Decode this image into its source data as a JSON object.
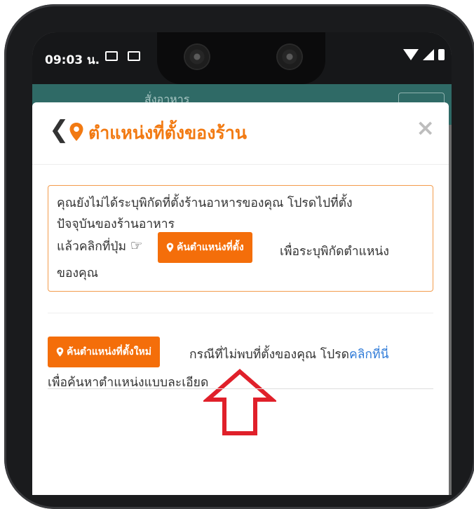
{
  "status_bar": {
    "time": "09:03 น.",
    "icons": [
      "gallery-icon",
      "gmail-icon",
      "wifi-icon",
      "signal-icon",
      "battery-icon"
    ]
  },
  "app_header": {
    "title": "สั่งอาหาร"
  },
  "modal": {
    "title": "ตำแหน่งที่ตั้งของร้าน",
    "close_label": "×",
    "back_label": "❮",
    "notice": {
      "line1": "คุณยังไม่ได้ระบุพิกัดที่ตั้งร้านอาหารของคุณ โปรดไปที่ตั้ง",
      "line2": "ปัจจุบันของร้านอาหาร",
      "line3_prefix": "แล้วคลิกที่ปุ่ม",
      "button_label": "ค้นตำแหน่งที่ตั้ง",
      "line3_suffix": "เพื่อระบุพิกัดตำแหน่ง",
      "line4": "ของคุณ"
    },
    "new_search_button": "ค้นตำแหน่งที่ตั้งใหม่",
    "help_text_prefix": "กรณีที่ไม่พบที่ตั้งของคุณ โปรด",
    "help_link": "คลิกที่นี่",
    "help_text_suffix": "เพื่อค้นหาตำแหน่งแบบละเอียด"
  },
  "colors": {
    "accent": "#f46e0a",
    "title": "#f27a12",
    "link": "#2f7bd8",
    "arrow": "#e0202a"
  }
}
